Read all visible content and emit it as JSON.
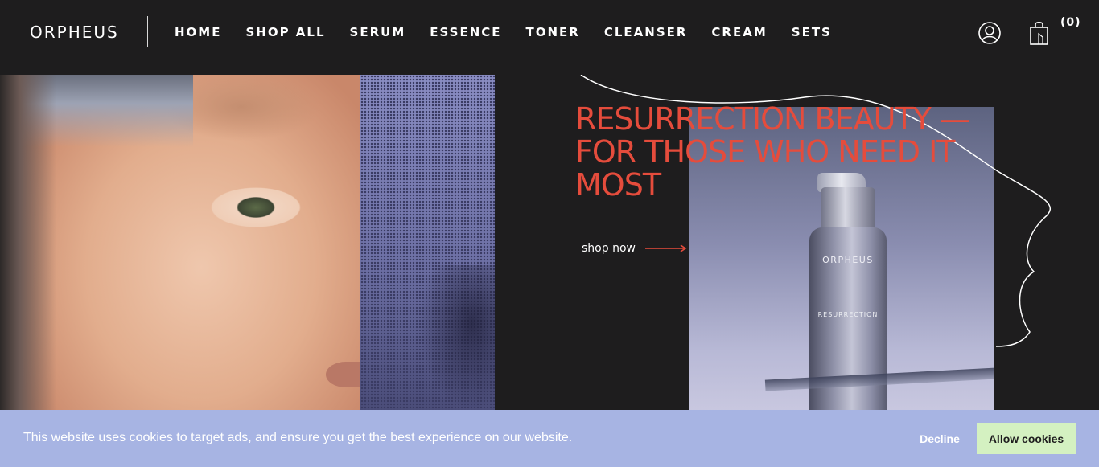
{
  "header": {
    "logo": "ORPHEUS",
    "nav": [
      {
        "label": "HOME"
      },
      {
        "label": "SHOP ALL"
      },
      {
        "label": "SERUM"
      },
      {
        "label": "ESSENCE"
      },
      {
        "label": "TONER"
      },
      {
        "label": "CLEANSER"
      },
      {
        "label": "CREAM"
      },
      {
        "label": "SETS"
      }
    ],
    "account_icon": "user-circle-icon",
    "cart_icon": "shopping-bag-icon",
    "cart_count": "(0)"
  },
  "hero": {
    "headline": "RESURRECTION BEAUTY — FOR THOSE WHO NEED IT MOST",
    "cta_label": "shop now",
    "cta_icon": "arrow-right-icon",
    "product": {
      "brand": "ORPHEUS",
      "name": "RESURRECTION"
    }
  },
  "cookie_banner": {
    "message": "This website uses cookies to target ads, and ensure you get the best experience on our website.",
    "decline_label": "Decline",
    "allow_label": "Allow cookies"
  },
  "colors": {
    "header_bg": "#1e1d1e",
    "headline": "#e54c3c",
    "cookie_banner_bg": "#a7b4e3",
    "allow_button_bg": "#d4f1c1"
  }
}
